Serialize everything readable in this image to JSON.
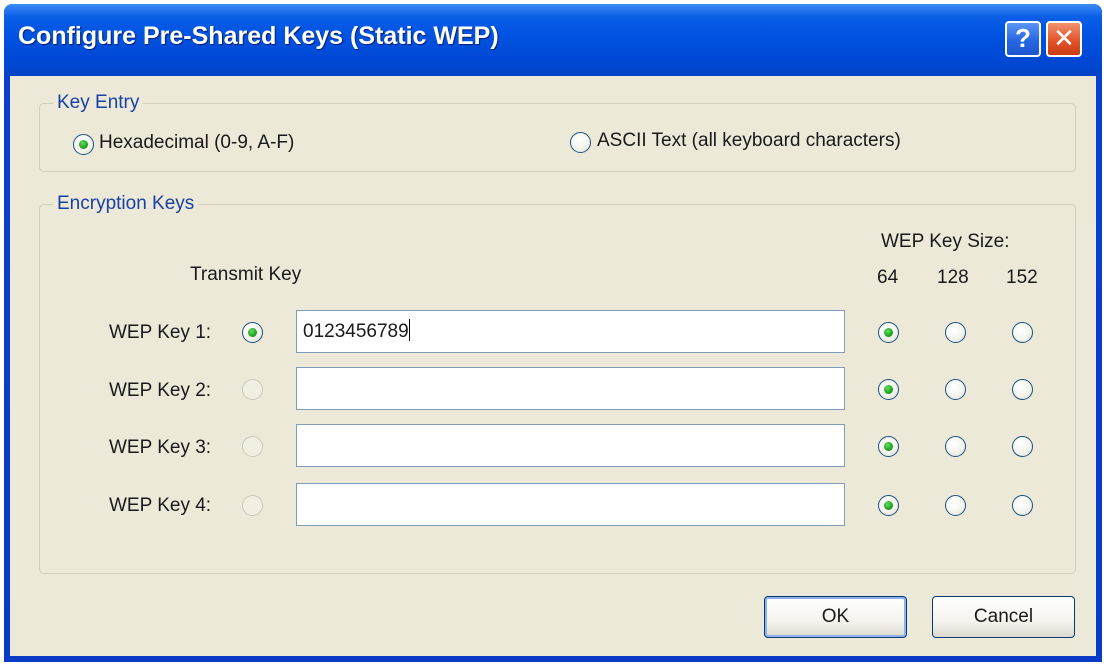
{
  "dialog": {
    "title": "Configure Pre-Shared Keys (Static WEP)",
    "help_label": "?",
    "close_label": "✕"
  },
  "key_entry": {
    "legend": "Key Entry",
    "options": [
      {
        "label": "Hexadecimal (0-9, A-F)",
        "selected": true
      },
      {
        "label": "ASCII Text (all keyboard characters)",
        "selected": false
      }
    ]
  },
  "encryption_keys": {
    "legend": "Encryption Keys",
    "transmit_key_header": "Transmit Key",
    "size_header": "WEP Key Size:",
    "size_options": [
      "64",
      "128",
      "152"
    ],
    "keys": [
      {
        "label": "WEP Key 1:",
        "value": "0123456789",
        "transmit": true,
        "size": "64"
      },
      {
        "label": "WEP Key 2:",
        "value": "",
        "transmit": false,
        "size": "64"
      },
      {
        "label": "WEP Key 3:",
        "value": "",
        "transmit": false,
        "size": "64"
      },
      {
        "label": "WEP Key 4:",
        "value": "",
        "transmit": false,
        "size": "64"
      }
    ]
  },
  "buttons": {
    "ok_label": "OK",
    "cancel_label": "Cancel"
  },
  "colors": {
    "title_bar": "#0052e0",
    "dialog_face": "#ece9d8",
    "legend_text": "#1941a5",
    "radio_dot": "#21a121"
  }
}
